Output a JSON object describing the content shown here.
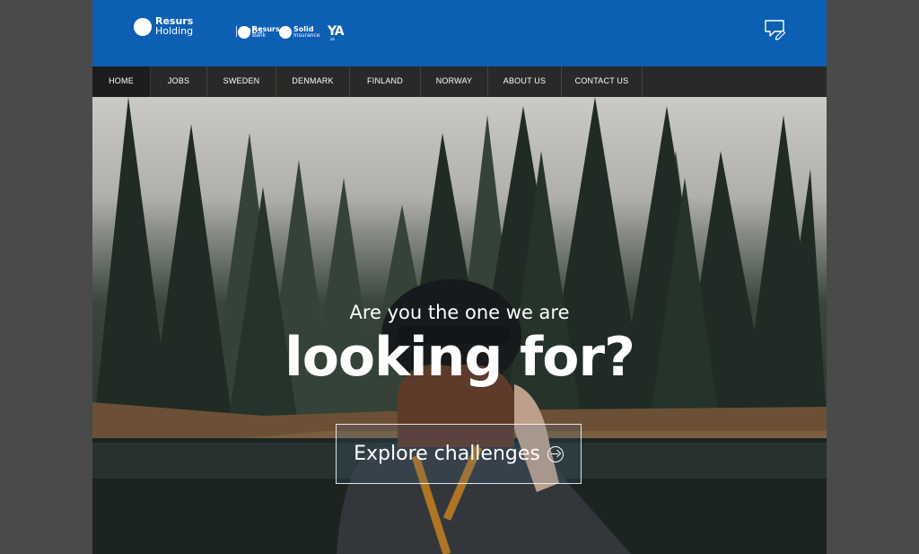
{
  "header": {
    "logo": {
      "line1": "Resurs",
      "line2": "Holding",
      "jobs": "Jobs"
    },
    "sub_logos": [
      {
        "name": "Resurs",
        "sub": "Bank"
      },
      {
        "name": "Solid",
        "sub": "Insurance"
      }
    ],
    "ya_logo": "YA",
    "ya_sub": "ab",
    "feedback_icon": "chat-pen-icon"
  },
  "nav": {
    "items": [
      {
        "label": "HOME",
        "active": true
      },
      {
        "label": "JOBS",
        "active": false
      },
      {
        "label": "SWEDEN",
        "active": false
      },
      {
        "label": "DENMARK",
        "active": false
      },
      {
        "label": "FINLAND",
        "active": false
      },
      {
        "label": "NORWAY",
        "active": false
      },
      {
        "label": "ABOUT US",
        "active": false
      },
      {
        "label": "CONTACT US",
        "active": false
      }
    ]
  },
  "hero": {
    "subtitle": "Are you the one we are",
    "title": "looking for?",
    "cta": "Explore challenges",
    "cta_icon": "arrow-right-circle-icon"
  },
  "colors": {
    "header_bg": "#0d5fb3",
    "nav_bg": "#2a2826",
    "outer_bg": "#4a4a4a"
  }
}
